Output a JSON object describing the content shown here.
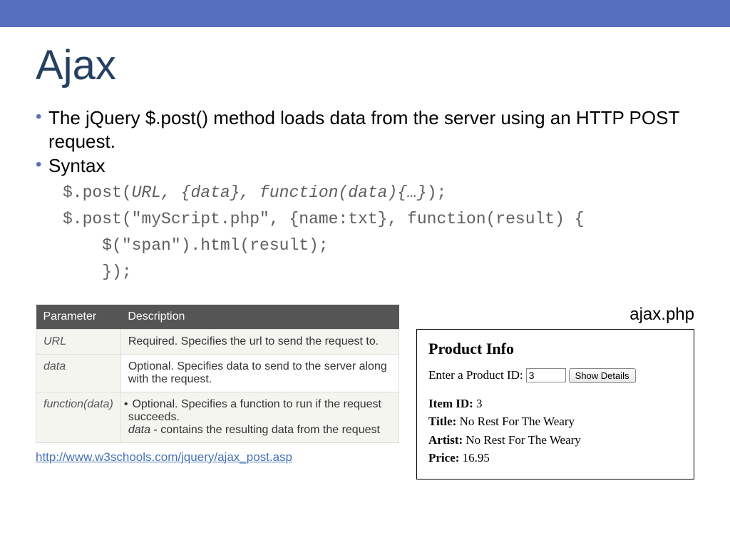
{
  "title": "Ajax",
  "bullets": {
    "b1": "The jQuery $.post() method loads data from the server using an HTTP POST request.",
    "b2": "Syntax"
  },
  "code": {
    "line1a": "$.post(",
    "line1b": "URL, {data}, function(data){…}",
    "line1c": ");",
    "line2": "$.post(\"myScript.php\", {name:txt}, function(result) {",
    "line3": "    $(\"span\").html(result);",
    "line4": "    });"
  },
  "table": {
    "headers": {
      "col1": "Parameter",
      "col2": "Description"
    },
    "rows": [
      {
        "param": "URL",
        "desc": "Required. Specifies the url to send the request to."
      },
      {
        "param": "data",
        "desc": "Optional. Specifies data to send to the server along with the request."
      },
      {
        "param": "function(data)",
        "desc_pre": "Optional. Specifies a function to run if the request succeeds.",
        "desc_em": "data",
        "desc_post": " - contains the resulting data from the request"
      }
    ]
  },
  "file_label": "ajax.php",
  "demo": {
    "heading": "Product Info",
    "prompt": "Enter a Product ID:",
    "input_value": "3",
    "button": "Show Details",
    "item_id_label": "Item ID:",
    "item_id_value": " 3",
    "title_label": "Title:",
    "title_value": " No Rest For The Weary",
    "artist_label": "Artist:",
    "artist_value": " No Rest For The Weary",
    "price_label": "Price:",
    "price_value": " 16.95"
  },
  "ref_link": "http://www.w3schools.com/jquery/ajax_post.asp"
}
